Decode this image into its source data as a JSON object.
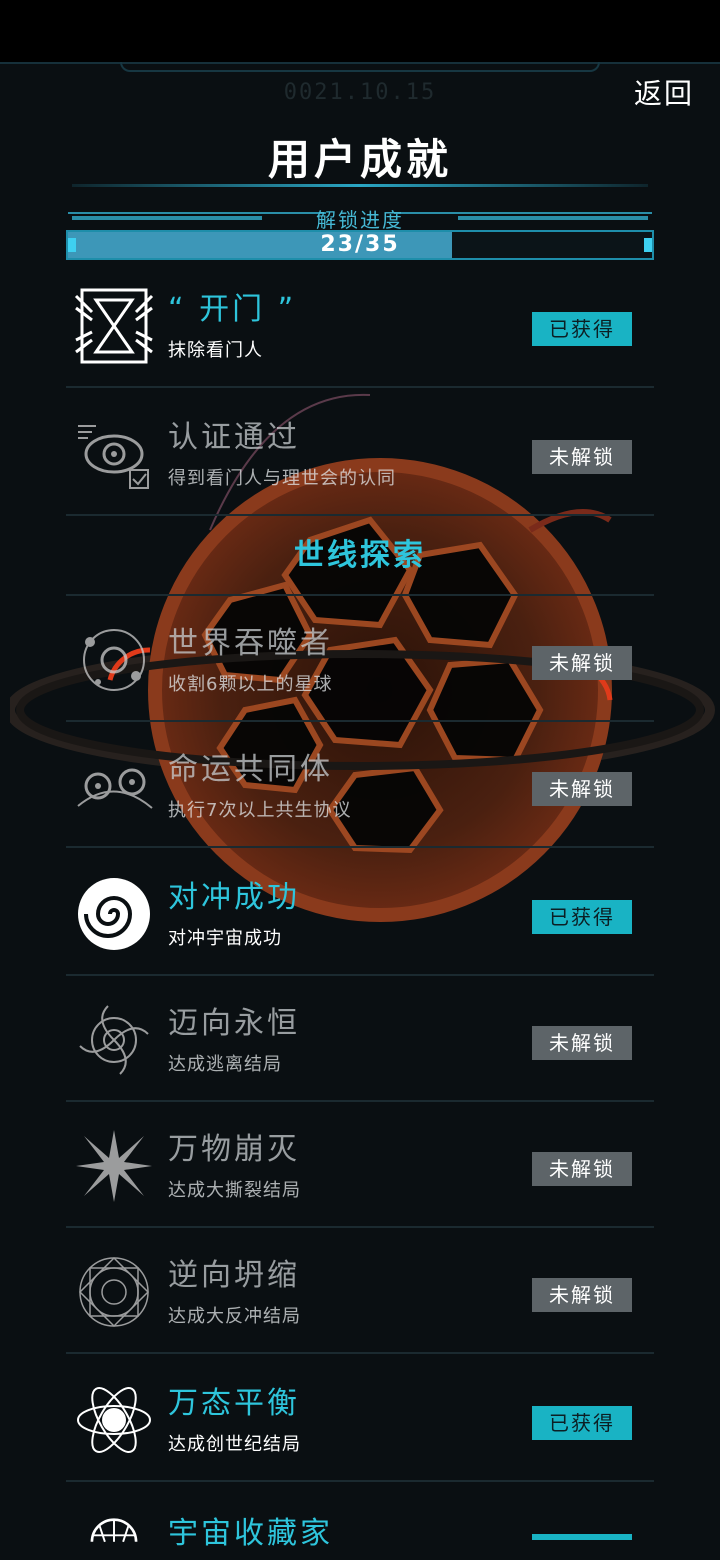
{
  "header": {
    "date": "0021.10.15",
    "back_label": "返回",
    "title": "用户成就"
  },
  "progress": {
    "label": "解锁进度",
    "value_text": "23/35",
    "unlocked": 23,
    "total": 35
  },
  "section_title": "世线探索",
  "badge_labels": {
    "earned": "已获得",
    "locked": "未解锁"
  },
  "achievements": [
    {
      "name": "“ 开门 ”",
      "desc": "抹除看门人",
      "status": "已获得",
      "icon": "door-hourglass-icon"
    },
    {
      "name": "认证通过",
      "desc": "得到看门人与理世会的认同",
      "status": "未解锁",
      "icon": "eye-verify-icon"
    },
    {
      "name": "世界吞噬者",
      "desc": "收割6颗以上的星球",
      "status": "未解锁",
      "icon": "planet-orbit-icon"
    },
    {
      "name": "命运共同体",
      "desc": "执行7次以上共生协议",
      "status": "未解锁",
      "icon": "twin-planet-icon"
    },
    {
      "name": "对冲成功",
      "desc": "对冲宇宙成功",
      "status": "已获得",
      "icon": "spiral-icon"
    },
    {
      "name": "迈向永恒",
      "desc": "达成逃离结局",
      "status": "未解锁",
      "icon": "vortex-icon"
    },
    {
      "name": "万物崩灭",
      "desc": "达成大撕裂结局",
      "status": "未解锁",
      "icon": "burst-icon"
    },
    {
      "name": "逆向坍缩",
      "desc": "达成大反冲结局",
      "status": "未解锁",
      "icon": "mandala-icon"
    },
    {
      "name": "万态平衡",
      "desc": "达成创世纪结局",
      "status": "已获得",
      "icon": "atom-icon"
    },
    {
      "name": "宇宙收藏家",
      "desc": "",
      "status": "",
      "icon": "dome-icon"
    }
  ],
  "colors": {
    "accent": "#2ec5dc",
    "earned_badge": "#19b3c4",
    "locked_badge": "#5d6468",
    "background": "#0a0f12"
  }
}
